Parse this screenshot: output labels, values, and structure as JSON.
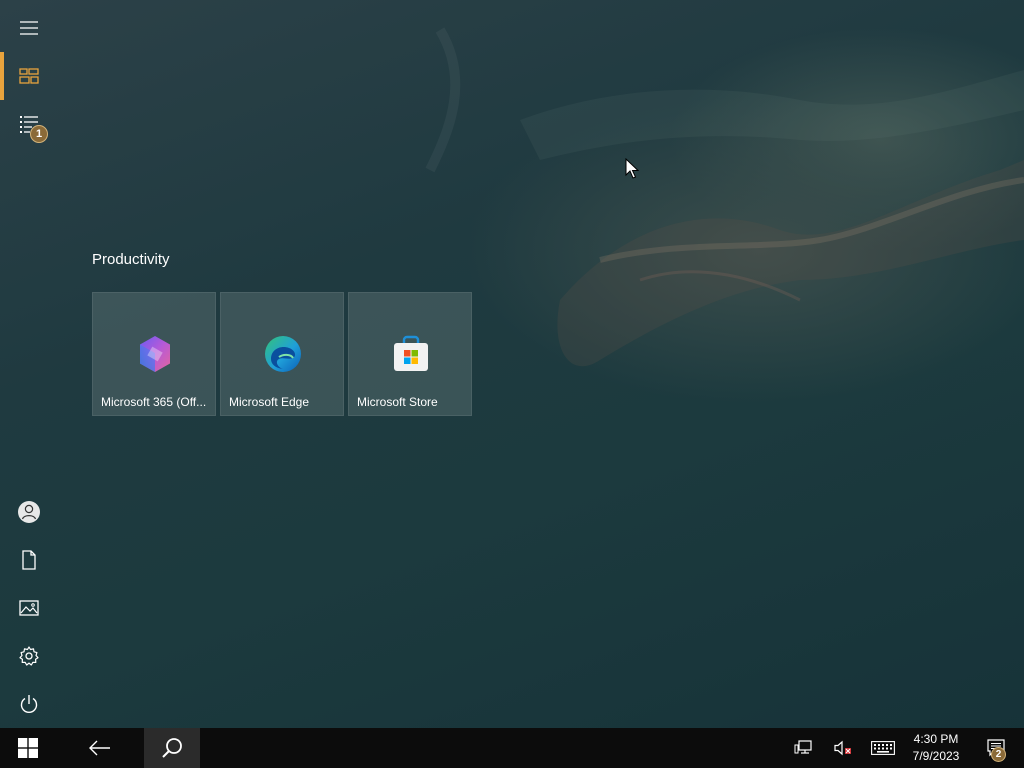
{
  "start_menu": {
    "group_title": "Productivity",
    "tiles": [
      {
        "label": "Microsoft 365 (Off...",
        "icon": "microsoft-365-icon"
      },
      {
        "label": "Microsoft Edge",
        "icon": "edge-icon"
      },
      {
        "label": "Microsoft Store",
        "icon": "store-icon"
      }
    ],
    "rail": {
      "expand_icon": "hamburger-icon",
      "pinned_icon": "tiles-icon",
      "all_apps_icon": "list-icon",
      "all_apps_badge": "1",
      "account_icon": "user-icon",
      "documents_icon": "document-icon",
      "pictures_icon": "picture-icon",
      "settings_icon": "gear-icon",
      "power_icon": "power-icon"
    },
    "accent_color": "#e8a33d"
  },
  "taskbar": {
    "start_icon": "windows-logo-icon",
    "back_icon": "back-arrow-icon",
    "search_icon": "search-icon",
    "tray": {
      "network_icon": "network-icon",
      "volume_icon": "volume-muted-icon",
      "keyboard_icon": "keyboard-icon"
    },
    "time": "4:30 PM",
    "date": "7/9/2023",
    "notifications_badge": "2"
  }
}
